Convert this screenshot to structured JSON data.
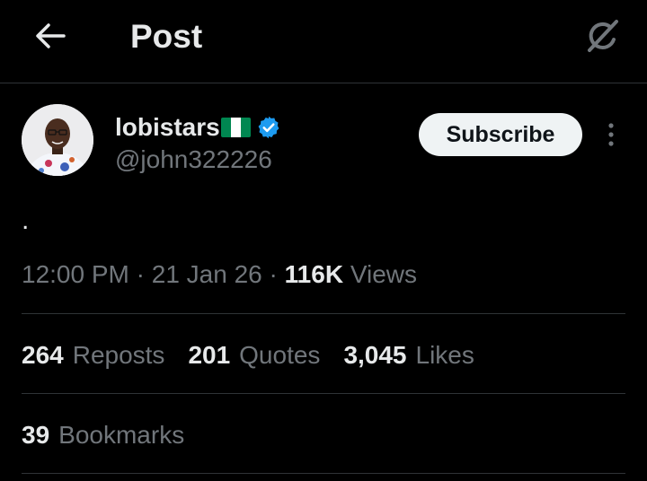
{
  "header": {
    "title": "Post",
    "back_icon": "arrow-left-icon",
    "grok_icon": "grok-icon"
  },
  "author": {
    "display_name": "lobistars",
    "flag": "nigeria-flag-icon",
    "verified_color": "#1d9bf0",
    "handle": "@john322226",
    "subscribe_label": "Subscribe"
  },
  "post": {
    "text": "."
  },
  "meta": {
    "time": "12:00 PM",
    "separator": "·",
    "date": "21 Jan 26",
    "views_count": "116K",
    "views_label": "Views"
  },
  "stats": {
    "reposts_count": "264",
    "reposts_label": "Reposts",
    "quotes_count": "201",
    "quotes_label": "Quotes",
    "likes_count": "3,045",
    "likes_label": "Likes",
    "bookmarks_count": "39",
    "bookmarks_label": "Bookmarks"
  },
  "colors": {
    "background": "#000000",
    "text": "#e7e9ea",
    "muted": "#71767b",
    "divider": "#2f3336",
    "flag_green": "#008751"
  }
}
